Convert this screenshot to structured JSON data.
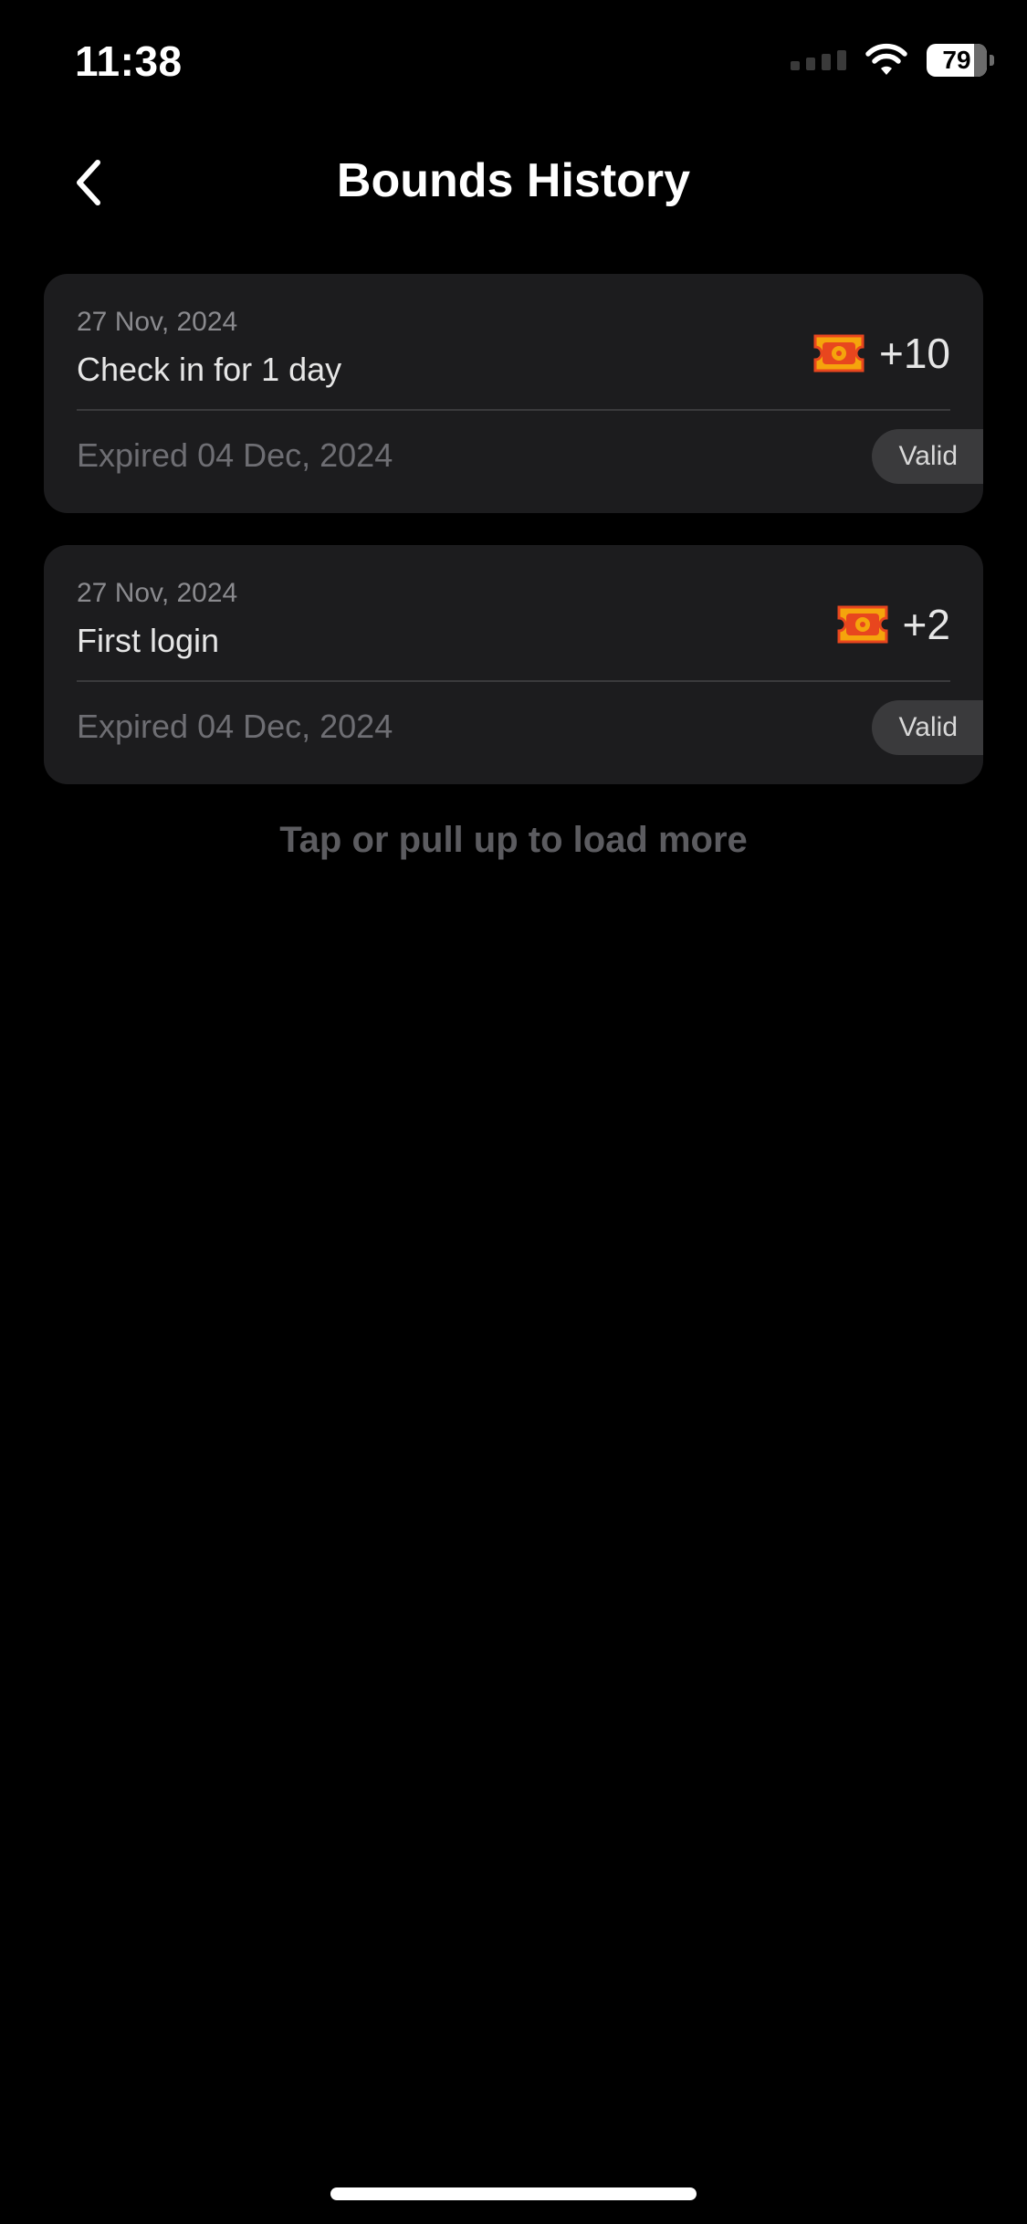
{
  "status_bar": {
    "time": "11:38",
    "battery_level": "79"
  },
  "header": {
    "title": "Bounds History",
    "back_icon": "chevron-left-icon"
  },
  "records": [
    {
      "date": "27 Nov, 2024",
      "title": "Check in for 1 day",
      "amount": "+10",
      "expiry": "Expired 04 Dec, 2024",
      "status": "Valid",
      "icon": "ticket-icon"
    },
    {
      "date": "27 Nov, 2024",
      "title": "First login",
      "amount": "+2",
      "expiry": "Expired 04 Dec, 2024",
      "status": "Valid",
      "icon": "ticket-icon"
    }
  ],
  "footer": {
    "load_more": "Tap or pull up to load more"
  },
  "colors": {
    "background": "#000000",
    "card": "#1c1c1e",
    "ticket_orange": "#f5a40c",
    "ticket_red": "#e8461e",
    "badge": "#3a3a3c"
  }
}
